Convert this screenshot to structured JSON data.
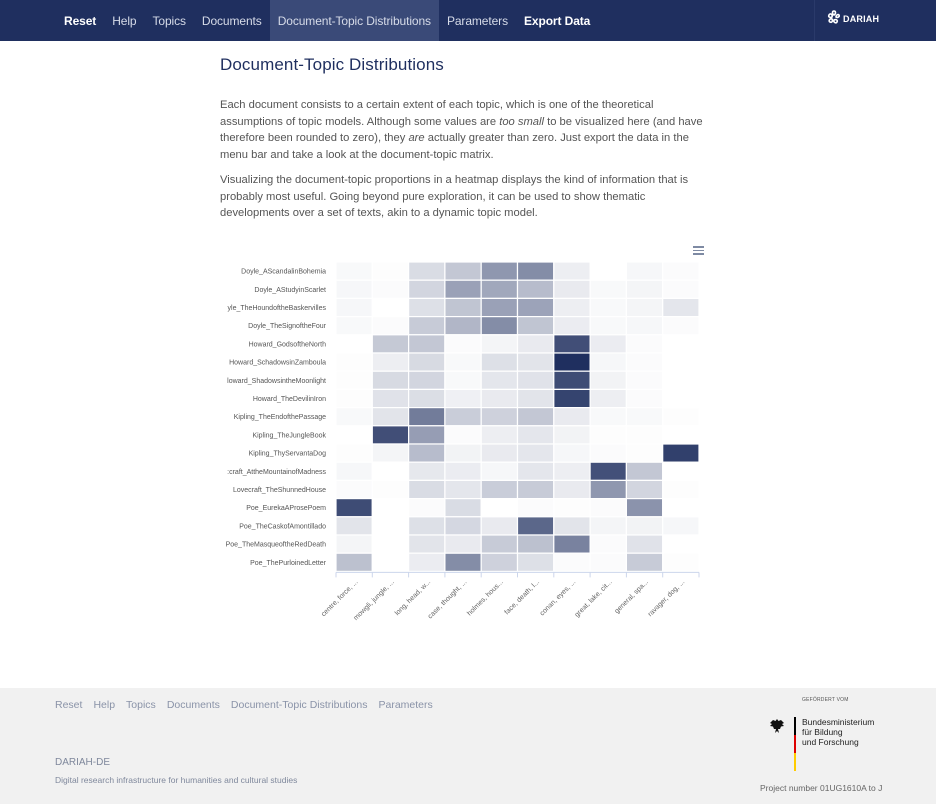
{
  "nav": {
    "items": [
      {
        "label": "Reset",
        "bold": true,
        "active": false
      },
      {
        "label": "Help",
        "bold": false,
        "active": false
      },
      {
        "label": "Topics",
        "bold": false,
        "active": false
      },
      {
        "label": "Documents",
        "bold": false,
        "active": false
      },
      {
        "label": "Document-Topic Distributions",
        "bold": false,
        "active": true
      },
      {
        "label": "Parameters",
        "bold": false,
        "active": false
      },
      {
        "label": "Export Data",
        "bold": true,
        "active": false
      }
    ],
    "brand": "DARIAH",
    "brand_icon": "dariah-flower-icon"
  },
  "main": {
    "title": "Document-Topic Distributions",
    "para1": {
      "before": "Each document consists to a certain extent of each topic, which is one of the theoretical assumptions of topic models. Although some values are ",
      "em1": "too small",
      "middle": " to be visualized here (and have therefore been rounded to zero), they ",
      "em2": "are",
      "after": " actually greater than zero. Just export the data in the menu bar and take a look at the document-topic matrix."
    },
    "para2": "Visualizing the document-topic proportions in a heatmap displays the kind of information that is probably most useful. Going beyond pure exploration, it can be used to show thematic developments over a set of texts, akin to a dynamic topic model.",
    "chart_menu_icon": "hamburger-menu-icon"
  },
  "chart_data": {
    "type": "heatmap",
    "title": "",
    "xlabel": "",
    "ylabel": "",
    "color_min": "#ffffff",
    "color_max": "#1f2f5f",
    "value_range": [
      0,
      1
    ],
    "grid": false,
    "legend": "none",
    "rows": [
      "Doyle_AScandalinBohemia",
      "Doyle_AStudyinScarlet",
      "Doyle_TheHoundoftheBaskervilles",
      "Doyle_TheSignoftheFour",
      "Howard_GodsoftheNorth",
      "Howard_SchadowsinZamboula",
      "Howard_ShadowsintheMoonlight",
      "Howard_TheDevilinIron",
      "Kipling_TheEndofthePassage",
      "Kipling_TheJungleBook",
      "Kipling_ThyServantaDog",
      "Lovecraft_AttheMountainofMadness",
      "Lovecraft_TheShunnedHouse",
      "Poe_EurekaAProsePoem",
      "Poe_TheCaskofAmontillado",
      "Poe_TheMasqueoftheRedDeath",
      "Poe_ThePurloinedLetter"
    ],
    "row_labels_displayed": [
      "Doyle_AScandalinBohemia",
      "Doyle_AStudyinScarlet",
      "yle_TheHoundoftheBaskervilles",
      "Doyle_TheSignoftheFour",
      "Howard_GodsoftheNorth",
      "Howard_SchadowsinZamboula",
      "loward_ShadowsintheMoonlight",
      "Howard_TheDevilinIron",
      "Kipling_TheEndofthePassage",
      "Kipling_TheJungleBook",
      "Kipling_ThyServantaDog",
      ":craft_AttheMountainofMadness",
      "Lovecraft_TheShunnedHouse",
      "Poe_EurekaAProsePoem",
      "Poe_TheCaskofAmontillado",
      "Poe_TheMasqueoftheRedDeath",
      "Poe_ThePurloinedLetter"
    ],
    "columns": [
      "centre, force, ...",
      "mowgli, jungle, ...",
      "long, head, w...",
      "case, thought, ...",
      "holmes, hous...",
      "face, death, l...",
      "conan, eyes, ...",
      "great, lake, cit...",
      "general, spa...",
      "ravager, dog, ..."
    ],
    "values": [
      [
        0.03,
        0.01,
        0.17,
        0.27,
        0.5,
        0.55,
        0.08,
        0.0,
        0.04,
        0.02
      ],
      [
        0.04,
        0.02,
        0.2,
        0.45,
        0.42,
        0.32,
        0.1,
        0.03,
        0.05,
        0.02
      ],
      [
        0.04,
        0.0,
        0.15,
        0.28,
        0.45,
        0.44,
        0.08,
        0.03,
        0.05,
        0.12
      ],
      [
        0.03,
        0.02,
        0.25,
        0.35,
        0.55,
        0.28,
        0.09,
        0.03,
        0.04,
        0.02
      ],
      [
        0.0,
        0.26,
        0.27,
        0.02,
        0.05,
        0.1,
        0.85,
        0.09,
        0.02,
        0.0
      ],
      [
        0.01,
        0.08,
        0.18,
        0.03,
        0.15,
        0.13,
        1.0,
        0.04,
        0.02,
        0.0
      ],
      [
        0.01,
        0.18,
        0.2,
        0.03,
        0.12,
        0.14,
        0.86,
        0.06,
        0.02,
        0.0
      ],
      [
        0.01,
        0.14,
        0.16,
        0.07,
        0.1,
        0.13,
        0.9,
        0.08,
        0.02,
        0.0
      ],
      [
        0.03,
        0.13,
        0.63,
        0.24,
        0.22,
        0.27,
        0.1,
        0.03,
        0.03,
        0.01
      ],
      [
        0.0,
        0.85,
        0.47,
        0.02,
        0.08,
        0.12,
        0.06,
        0.01,
        0.01,
        0.0
      ],
      [
        0.01,
        0.05,
        0.32,
        0.06,
        0.1,
        0.12,
        0.04,
        0.02,
        0.01,
        0.92
      ],
      [
        0.04,
        0.0,
        0.11,
        0.09,
        0.04,
        0.12,
        0.08,
        0.84,
        0.27,
        0.0
      ],
      [
        0.02,
        0.01,
        0.17,
        0.12,
        0.24,
        0.25,
        0.1,
        0.5,
        0.2,
        0.01
      ],
      [
        0.86,
        0.0,
        0.02,
        0.17,
        0.0,
        0.02,
        0.01,
        0.02,
        0.52,
        0.0
      ],
      [
        0.13,
        0.0,
        0.15,
        0.19,
        0.1,
        0.73,
        0.13,
        0.05,
        0.06,
        0.04
      ],
      [
        0.05,
        0.0,
        0.13,
        0.1,
        0.25,
        0.3,
        0.6,
        0.02,
        0.14,
        0.0
      ],
      [
        0.3,
        0.0,
        0.09,
        0.55,
        0.22,
        0.15,
        0.02,
        0.02,
        0.25,
        0.01
      ]
    ]
  },
  "footer": {
    "links": [
      "Reset",
      "Help",
      "Topics",
      "Documents",
      "Document-Topic Distributions",
      "Parameters"
    ],
    "org": "DARIAH-DE",
    "description": "Digital research infrastructure for humanities and cultural studies",
    "funded_by": "GEFÖRDERT VOM",
    "ministry_lines": [
      "Bundesministerium",
      "für Bildung",
      "und Forschung"
    ],
    "ministry_icon": "federal-eagle-icon",
    "flag_colors": [
      "#000000",
      "#dd0000",
      "#ffcc00"
    ],
    "project_number": "Project number 01UG1610A to J"
  }
}
